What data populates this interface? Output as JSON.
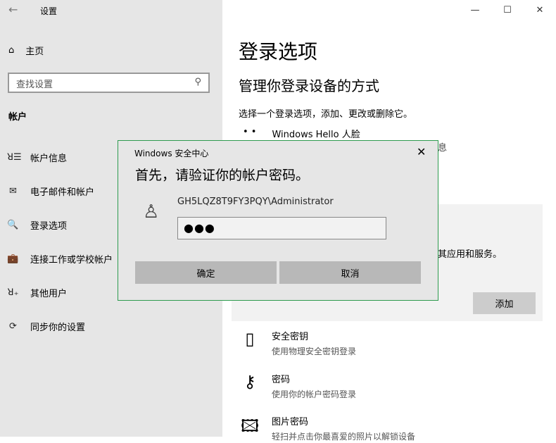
{
  "window": {
    "title": "设置",
    "back": "←",
    "minimize": "—",
    "maximize": "☐",
    "close": "✕"
  },
  "sidebar": {
    "home": "主页",
    "search_placeholder": "查找设置",
    "section": "帐户",
    "items": [
      {
        "label": "帐户信息",
        "icon": "ꓤ☰"
      },
      {
        "label": "电子邮件和帐户",
        "icon": "✉"
      },
      {
        "label": "登录选项",
        "icon": "🔍"
      },
      {
        "label": "连接工作或学校帐户",
        "icon": "💼"
      },
      {
        "label": "其他用户",
        "icon": "ꓤ₊"
      },
      {
        "label": "同步你的设置",
        "icon": "⟳"
      }
    ]
  },
  "main": {
    "title": "登录选项",
    "subtitle": "管理你登录设备的方式",
    "desc": "选择一个登录选项，添加、更改或删除它。",
    "hello_face": "Windows Hello 人脸",
    "partial_text1": "息",
    "partial_text2": "其应用和服务。",
    "add_button": "添加",
    "options": [
      {
        "title": "安全密钥",
        "sub": "使用物理安全密钥登录",
        "icon": "▯"
      },
      {
        "title": "密码",
        "sub": "使用你的帐户密码登录",
        "icon": "⚷"
      },
      {
        "title": "图片密码",
        "sub": "轻扫并点击你最喜爱的照片以解锁设备",
        "icon": "🖾"
      }
    ]
  },
  "dialog": {
    "title": "Windows 安全中心",
    "heading": "首先，请验证你的帐户密码。",
    "account": "GH5LQZ8T9FY3PQY\\Administrator",
    "password": "●●●",
    "ok": "确定",
    "cancel": "取消",
    "close": "✕"
  }
}
